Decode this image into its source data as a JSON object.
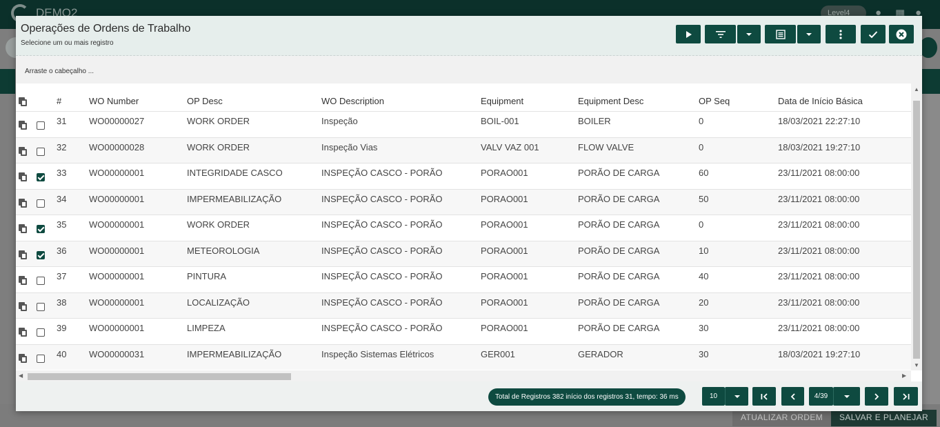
{
  "app": {
    "name": "DEMO2",
    "level": "Level4",
    "update_button": "ATUALIZAR ORDEM",
    "save_button": "SALVAR E PLANEJAR"
  },
  "modal": {
    "title": "Operações de Ordens de Trabalho",
    "subtitle": "Selecione um ou mais registro",
    "group_hint": "Arraste o cabeçalho ..."
  },
  "toolbar": {
    "icons": [
      "play-icon",
      "filter-icon",
      "caret-down-icon",
      "columns-icon",
      "caret-down-icon",
      "more-vert-icon",
      "check-icon",
      "close-circle-icon"
    ]
  },
  "grid": {
    "columns": [
      "#",
      "WO Number",
      "OP Desc",
      "WO Description",
      "Equipment",
      "Equipment Desc",
      "OP Seq",
      "Data de Início Básica"
    ],
    "rows": [
      {
        "n": "31",
        "wo": "WO00000027",
        "op": "WORK ORDER",
        "desc": "Inspeção",
        "eq": "BOIL-001",
        "eqd": "BOILER",
        "seq": "0",
        "date": "18/03/2021 22:27:10",
        "checked": false
      },
      {
        "n": "32",
        "wo": "WO00000028",
        "op": "WORK ORDER",
        "desc": "Inspeção Vias",
        "eq": "VALV VAZ 001",
        "eqd": "FLOW VALVE",
        "seq": "0",
        "date": "18/03/2021 19:27:10",
        "checked": false
      },
      {
        "n": "33",
        "wo": "WO00000001",
        "op": "INTEGRIDADE CASCO",
        "desc": "INSPEÇÃO CASCO - PORÃO",
        "eq": "PORAO001",
        "eqd": "PORÃO DE CARGA",
        "seq": "60",
        "date": "23/11/2021 08:00:00",
        "checked": true
      },
      {
        "n": "34",
        "wo": "WO00000001",
        "op": "IMPERMEABILIZAÇÃO",
        "desc": "INSPEÇÃO CASCO - PORÃO",
        "eq": "PORAO001",
        "eqd": "PORÃO DE CARGA",
        "seq": "50",
        "date": "23/11/2021 08:00:00",
        "checked": false
      },
      {
        "n": "35",
        "wo": "WO00000001",
        "op": "WORK ORDER",
        "desc": "INSPEÇÃO CASCO - PORÃO",
        "eq": "PORAO001",
        "eqd": "PORÃO DE CARGA",
        "seq": "0",
        "date": "23/11/2021 08:00:00",
        "checked": true
      },
      {
        "n": "36",
        "wo": "WO00000001",
        "op": "METEOROLOGIA",
        "desc": "INSPEÇÃO CASCO - PORÃO",
        "eq": "PORAO001",
        "eqd": "PORÃO DE CARGA",
        "seq": "10",
        "date": "23/11/2021 08:00:00",
        "checked": true
      },
      {
        "n": "37",
        "wo": "WO00000001",
        "op": "PINTURA",
        "desc": "INSPEÇÃO CASCO - PORÃO",
        "eq": "PORAO001",
        "eqd": "PORÃO DE CARGA",
        "seq": "40",
        "date": "23/11/2021 08:00:00",
        "checked": false
      },
      {
        "n": "38",
        "wo": "WO00000001",
        "op": "LOCALIZAÇÃO",
        "desc": "INSPEÇÃO CASCO - PORÃO",
        "eq": "PORAO001",
        "eqd": "PORÃO DE CARGA",
        "seq": "20",
        "date": "23/11/2021 08:00:00",
        "checked": false
      },
      {
        "n": "39",
        "wo": "WO00000001",
        "op": "LIMPEZA",
        "desc": "INSPEÇÃO CASCO - PORÃO",
        "eq": "PORAO001",
        "eqd": "PORÃO DE CARGA",
        "seq": "30",
        "date": "23/11/2021 08:00:00",
        "checked": false
      },
      {
        "n": "40",
        "wo": "WO00000031",
        "op": "IMPERMEABILIZAÇÃO",
        "desc": "Inspeção Sistemas Elétricos",
        "eq": "GER001",
        "eqd": "GERADOR",
        "seq": "30",
        "date": "18/03/2021 19:27:10",
        "checked": false
      }
    ]
  },
  "footer": {
    "total_text": "Total de Registros 382 início dos registros 31, tempo: 36 ms",
    "page_size": "10",
    "page_indicator": "4/39"
  },
  "colors": {
    "accent": "#0e4a40",
    "header_bg": "#e6eeec"
  }
}
